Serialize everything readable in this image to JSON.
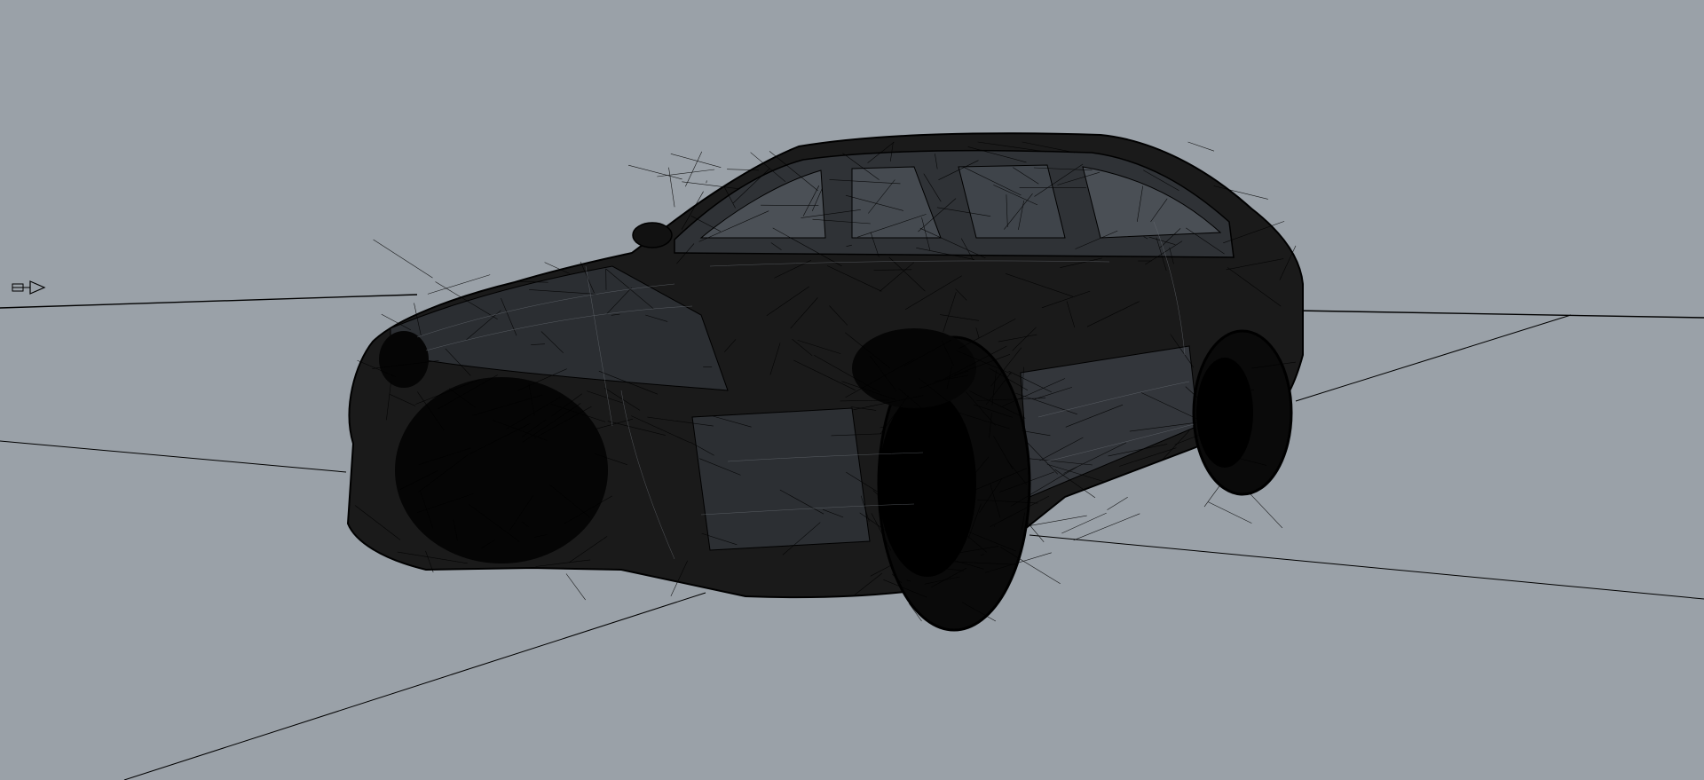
{
  "viewport": {
    "background_color": "#9aa1a8",
    "line_color": "#000000",
    "display_mode": "wireframe",
    "icons": {
      "cplane_marker": "cplane-arrow-icon"
    }
  }
}
